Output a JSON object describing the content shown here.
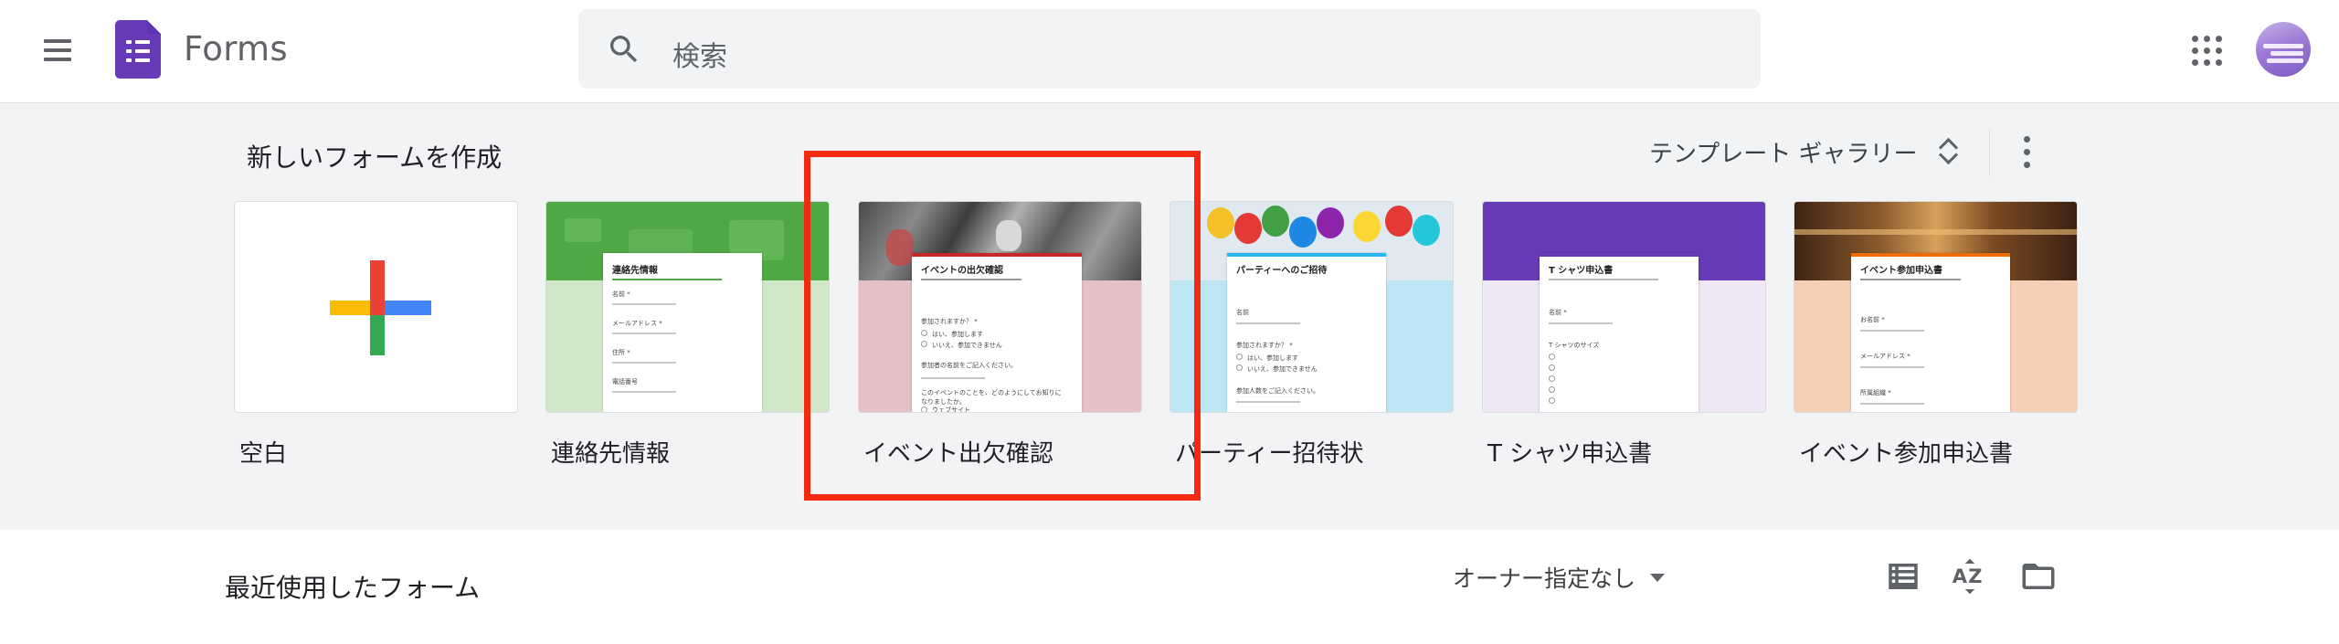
{
  "app": {
    "title": "Forms"
  },
  "search": {
    "placeholder": "検索"
  },
  "templates": {
    "section_title": "新しいフォームを作成",
    "gallery_label": "テンプレート ギャラリー",
    "items": [
      {
        "name": "空白"
      },
      {
        "name": "連絡先情報",
        "thumb_title": "連絡先情報",
        "fields": [
          "名前 *",
          "メールアドレス *",
          "住所 *",
          "電話番号"
        ]
      },
      {
        "name": "イベント出欠確認",
        "thumb_title": "イベントの出欠確認",
        "fields": [
          "参加されますか？ *",
          "はい、参加します",
          "いいえ、参加できません",
          "参加者の名前をご記入ください。",
          "このイベントのことを、どのようにしてお知りになりましたか。",
          "ウェブサイト"
        ]
      },
      {
        "name": "パーティー招待状",
        "thumb_title": "パーティーへのご招待",
        "fields": [
          "名前",
          "参加されますか？ *",
          "はい、参加します",
          "いいえ、参加できません",
          "参加人数をご記入ください。"
        ]
      },
      {
        "name": "T シャツ申込書",
        "thumb_title": "T シャツ申込書",
        "fields": [
          "名前 *",
          "T シャツのサイズ"
        ]
      },
      {
        "name": "イベント参加申込書",
        "thumb_title": "イベント参加申込書",
        "fields": [
          "お名前 *",
          "メールアドレス *",
          "所属組織 *"
        ]
      }
    ]
  },
  "recent": {
    "title": "最近使用したフォーム",
    "owner_filter": "オーナー指定なし"
  },
  "colors": {
    "brand_purple": "#673ab7",
    "highlight_red": "#f02b12",
    "background_gray": "#f1f3f4"
  },
  "icons": [
    "menu-icon",
    "forms-logo-icon",
    "search-icon",
    "apps-grid-icon",
    "avatar",
    "sort-updown-icon",
    "more-vert-icon",
    "list-view-icon",
    "sort-az-icon",
    "folder-icon"
  ]
}
